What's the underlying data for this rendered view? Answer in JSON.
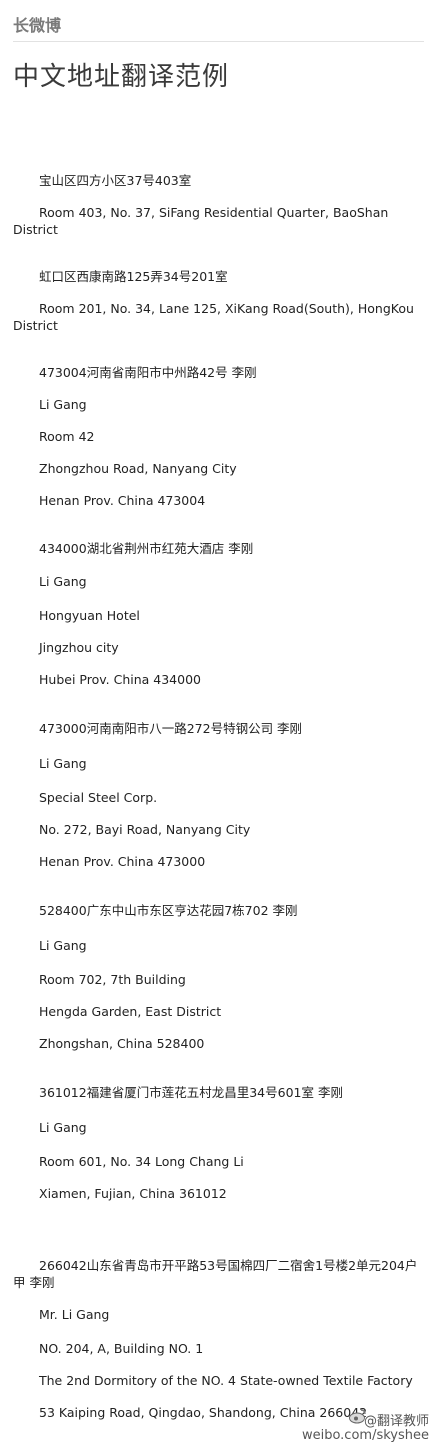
{
  "header": {
    "label": "长微博"
  },
  "page_title": "中文地址翻译范例",
  "lines": [
    "宝山区四方小区37号403室",
    "Room 403, No. 37, SiFang Residential Quarter, BaoShan District",
    "虹口区西康南路125弄34号201室",
    "Room 201, No. 34, Lane 125, XiKang Road(South), HongKou District",
    "473004河南省南阳市中州路42号 李刚",
    "Li Gang",
    "Room 42",
    "Zhongzhou Road, Nanyang City",
    "Henan Prov. China 473004",
    "434000湖北省荆州市红苑大酒店 李刚",
    "Li Gang",
    "Hongyuan Hotel",
    "Jingzhou city",
    "Hubei Prov. China 434000",
    "473000河南南阳市八一路272号特钢公司 李刚",
    "Li Gang",
    "Special Steel Corp.",
    "No. 272, Bayi Road, Nanyang City",
    "Henan Prov. China 473000",
    "528400广东中山市东区亨达花园7栋702 李刚",
    "Li Gang",
    "Room 702, 7th Building",
    "Hengda Garden, East District",
    "Zhongshan, China 528400",
    "361012福建省厦门市莲花五村龙昌里34号601室 李刚",
    "Li Gang",
    "Room 601, No. 34 Long Chang Li",
    "Xiamen, Fujian, China 361012",
    "266042山东省青岛市开平路53号国棉四厂二宿舍1号楼2单元204户甲 李刚",
    "Mr. Li Gang",
    "NO. 204, A, Building NO. 1",
    "The 2nd Dormitory of the NO. 4 State-owned Textile Factory",
    "53 Kaiping Road, Qingdao, Shandong, China 266042"
  ],
  "watermark": {
    "logo_icon": "weibo-logo-icon",
    "name": "@翻译教师",
    "url": "weibo.com/skyshee"
  }
}
